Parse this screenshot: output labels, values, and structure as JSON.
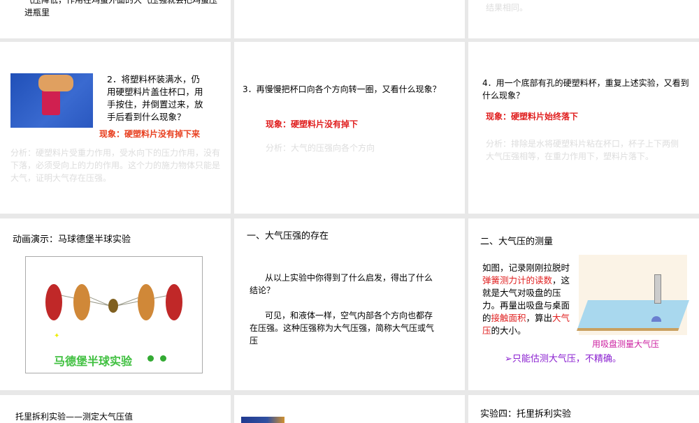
{
  "slides": [
    {
      "text": "气压降低，作用在鸡蛋外面的大气压强就会把鸡蛋压进瓶里"
    },
    {
      "text": ""
    },
    {
      "faint": "结果相同。"
    },
    {
      "question": "2．将塑料杯装满水，仍用硬塑料片盖住杯口，用手按住，并倒置过来，放手后看到什么现象？",
      "phenomenon": "现象：硬塑料片没有掉下来",
      "analysis": "分析：硬塑料片受重力作用，受水向下的压力作用，没有下落，必须受向上的力的作用。这个力的施力物体只能是大气，证明大气存在压强。"
    },
    {
      "question": "3．再慢慢把杯口向各个方向转一圈，又看什么现象？",
      "phenomenon": "现象：硬塑料片没有掉下",
      "analysis": "分析：大气的压强向各个方向"
    },
    {
      "question": "4．用一个底部有孔的硬塑料杯，重复上述实验，又看到什么现象？",
      "phenomenon": "现象：硬塑料片始终落下",
      "analysis": "分析：排除是水将硬塑料片粘在杯口，杯子上下两侧大气压强相等，在重力作用下，塑料片落下。"
    },
    {
      "title": "动画演示：马球德堡半球实验",
      "animation_caption": "马德堡半球实验"
    },
    {
      "title": "一、大气压强的存在",
      "question": "从以上实验中你得到了什么启发，得出了什么结论？",
      "answer": "可见，和液体一样，空气内部各个方向也都存在压强。这种压强称为大气压强，简称大气压或气压"
    },
    {
      "title": "二、大气压的测量",
      "p1": "如图，记录刚刚拉脱时",
      "p2": "弹簧测力计的读数",
      "p3": "，这就是大气对吸盘的压力。再量出吸盘与桌面的",
      "p4": "接触面积",
      "p5": "，算出",
      "p6": "大气压",
      "p7": "的大小。",
      "caption": "用吸盘测量大气压",
      "note": "➢只能估测大气压，不精确。"
    },
    {
      "title": "托里拆利实验——测定大气压值"
    },
    {
      "title": ""
    },
    {
      "title": "实验四：托里拆利实验"
    }
  ]
}
